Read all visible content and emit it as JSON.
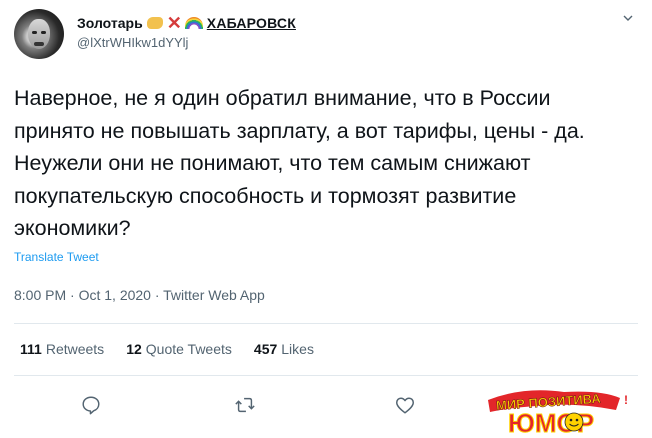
{
  "author": {
    "display_name": "Золотарь",
    "city": "ХАБАРОВСК",
    "handle": "@lXtrWHIkw1dYYlj"
  },
  "tweet": {
    "text": "Наверное, не я один обратил внимание, что в России принято не повышать зарплату, а вот тарифы, цены - да. Неужели они не понимают, что тем самым снижают покупательскую способность и тормозят развитие экономики?",
    "translate_label": "Translate Tweet",
    "meta": "8:00 PM · Oct 1, 2020 · Twitter Web App"
  },
  "stats": [
    {
      "num": "111",
      "label": "Retweets"
    },
    {
      "num": "12",
      "label": "Quote Tweets"
    },
    {
      "num": "457",
      "label": "Likes"
    }
  ],
  "icons": {
    "caret": "chevron-down-icon",
    "reply": "reply-icon",
    "retweet": "retweet-icon",
    "like": "heart-icon"
  },
  "watermark": {
    "line1": "МИР ПОЗИТИВА",
    "line2": "ЮМОР"
  },
  "colors": {
    "text": "#0f1419",
    "secondary": "#536471",
    "link": "#1d9bf0",
    "divider": "#e1e8ed"
  }
}
